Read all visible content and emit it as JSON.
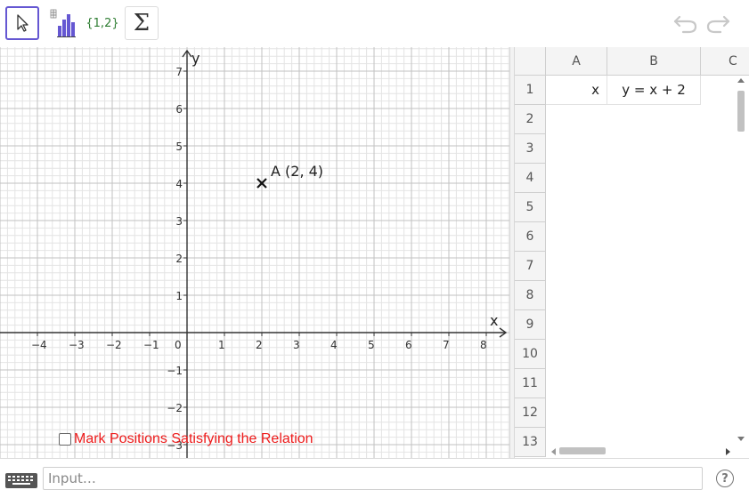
{
  "toolbar": {
    "tools": [
      {
        "name": "move-tool",
        "icon": "cursor-arrow-icon"
      },
      {
        "name": "statistics-tool",
        "icon": "bar-chart-icon"
      },
      {
        "name": "list-tool",
        "label": "{1,2}"
      },
      {
        "name": "sum-tool",
        "label": "Σ"
      }
    ],
    "undo_icon": "undo-icon",
    "redo_icon": "redo-icon",
    "accent": "#6557d2"
  },
  "graphics": {
    "x_axis_label": "x",
    "y_axis_label": "y",
    "x_ticks": [
      "−4",
      "−3",
      "−2",
      "−1",
      "0",
      "1",
      "2",
      "3",
      "4",
      "5",
      "6",
      "7",
      "8"
    ],
    "y_ticks": [
      "7",
      "6",
      "5",
      "4",
      "3",
      "2",
      "1",
      "−1",
      "−2",
      "−3"
    ],
    "point": {
      "name": "A",
      "label": "A (2, 4)",
      "x": 2,
      "y": 4
    },
    "checkbox": {
      "label": "Mark Positions Satisfying the Relation",
      "checked": false,
      "color": "#ee1c1c"
    }
  },
  "spreadsheet": {
    "columns": [
      "A",
      "B",
      "C"
    ],
    "rows": [
      "1",
      "2",
      "3",
      "4",
      "5",
      "6",
      "7",
      "8",
      "9",
      "10",
      "11",
      "12",
      "13"
    ],
    "cells": {
      "A1": "x",
      "B1": "y = x + 2"
    }
  },
  "input_bar": {
    "placeholder": "Input…",
    "keyboard_icon": "keyboard-icon",
    "help_label": "?"
  }
}
